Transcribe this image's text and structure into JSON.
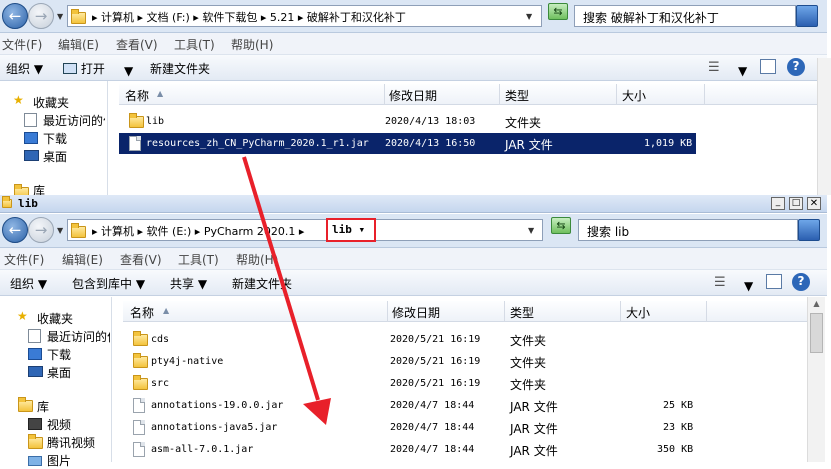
{
  "w1": {
    "breadcrumbs": [
      "计算机",
      "文档 (F:)",
      "软件下载包",
      "5.21",
      "破解补丁和汉化补丁"
    ],
    "search": "搜索 破解补丁和汉化补丁",
    "menu": [
      "文件(F)",
      "编辑(E)",
      "查看(V)",
      "工具(T)",
      "帮助(H)"
    ],
    "toolbar": {
      "organize": "组织",
      "open": "打开",
      "newfolder": "新建文件夹"
    },
    "nav": {
      "favorites": "收藏夹",
      "recent": "最近访问的位",
      "downloads": "下载",
      "desktop": "桌面",
      "libraries": "库"
    },
    "columns": {
      "name": "名称",
      "modified": "修改日期",
      "type": "类型",
      "size": "大小"
    },
    "rows": [
      {
        "name": "lib",
        "date": "2020/4/13 18:03",
        "type": "文件夹",
        "size": ""
      },
      {
        "name": "resources_zh_CN_PyCharm_2020.1_r1.jar",
        "date": "2020/4/13 16:50",
        "type": "JAR 文件",
        "size": "1,019 KB"
      }
    ]
  },
  "w2": {
    "title": "lib",
    "breadcrumbs": [
      "计算机",
      "软件 (E:)",
      "PyCharm 2020.1"
    ],
    "current": "lib",
    "search": "搜索 lib",
    "menu": [
      "文件(F)",
      "编辑(E)",
      "查看(V)",
      "工具(T)",
      "帮助(H)"
    ],
    "toolbar": {
      "organize": "组织",
      "include": "包含到库中",
      "share": "共享",
      "newfolder": "新建文件夹"
    },
    "nav": {
      "favorites": "收藏夹",
      "recent": "最近访问的位",
      "downloads": "下载",
      "desktop": "桌面",
      "libraries": "库",
      "videos": "视频",
      "tencent": "腾讯视频",
      "pictures": "图片"
    },
    "columns": {
      "name": "名称",
      "modified": "修改日期",
      "type": "类型",
      "size": "大小"
    },
    "rows": [
      {
        "name": "cds",
        "date": "2020/5/21 16:19",
        "type": "文件夹",
        "size": ""
      },
      {
        "name": "pty4j-native",
        "date": "2020/5/21 16:19",
        "type": "文件夹",
        "size": ""
      },
      {
        "name": "src",
        "date": "2020/5/21 16:19",
        "type": "文件夹",
        "size": ""
      },
      {
        "name": "annotations-19.0.0.jar",
        "date": "2020/4/7 18:44",
        "type": "JAR 文件",
        "size": "25 KB"
      },
      {
        "name": "annotations-java5.jar",
        "date": "2020/4/7 18:44",
        "type": "JAR 文件",
        "size": "23 KB"
      },
      {
        "name": "asm-all-7.0.1.jar",
        "date": "2020/4/7 18:44",
        "type": "JAR 文件",
        "size": "350 KB"
      }
    ]
  },
  "colors": {
    "arrow": "#e8202a",
    "highlight": "#e8202a",
    "selection": "#0a246a"
  }
}
